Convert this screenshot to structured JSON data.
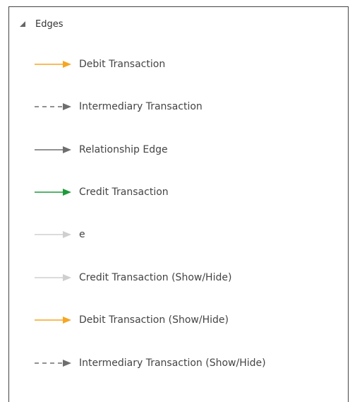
{
  "group": {
    "label": "Edges",
    "icon": "caret-expanded-icon"
  },
  "items": [
    {
      "label": "Debit Transaction",
      "color": "#f5a623",
      "style": "solid"
    },
    {
      "label": "Intermediary Transaction",
      "color": "#6e6e6e",
      "style": "dashed"
    },
    {
      "label": "Relationship Edge",
      "color": "#6e6e6e",
      "style": "solid"
    },
    {
      "label": "Credit Transaction",
      "color": "#1f9a3a",
      "style": "solid"
    },
    {
      "label": "e",
      "color": "#cfcfcf",
      "style": "solid"
    },
    {
      "label": "Credit Transaction (Show/Hide)",
      "color": "#cfcfcf",
      "style": "solid"
    },
    {
      "label": "Debit Transaction (Show/Hide)",
      "color": "#f5a623",
      "style": "solid"
    },
    {
      "label": "Intermediary Transaction (Show/Hide)",
      "color": "#6e6e6e",
      "style": "dashed"
    }
  ]
}
